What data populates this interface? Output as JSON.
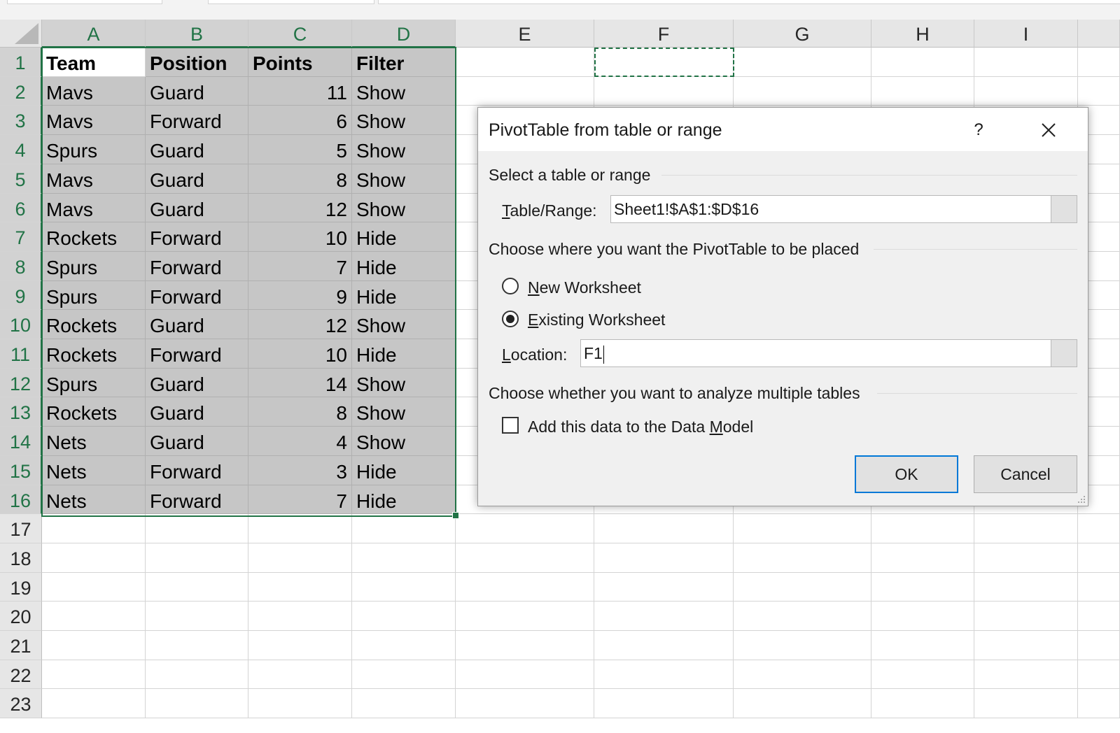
{
  "columns": [
    "A",
    "B",
    "C",
    "D",
    "E",
    "F",
    "G",
    "H",
    "I"
  ],
  "rows": [
    "1",
    "2",
    "3",
    "4",
    "5",
    "6",
    "7",
    "8",
    "9",
    "10",
    "11",
    "12",
    "13",
    "14",
    "15",
    "16",
    "17",
    "18",
    "19",
    "20",
    "21",
    "22",
    "23"
  ],
  "table": {
    "header": [
      "Team",
      "Position",
      "Points",
      "Filter"
    ],
    "rows": [
      [
        "Mavs",
        "Guard",
        "11",
        "Show"
      ],
      [
        "Mavs",
        "Forward",
        "6",
        "Show"
      ],
      [
        "Spurs",
        "Guard",
        "5",
        "Show"
      ],
      [
        "Mavs",
        "Guard",
        "8",
        "Show"
      ],
      [
        "Mavs",
        "Guard",
        "12",
        "Show"
      ],
      [
        "Rockets",
        "Forward",
        "10",
        "Hide"
      ],
      [
        "Spurs",
        "Forward",
        "7",
        "Hide"
      ],
      [
        "Spurs",
        "Forward",
        "9",
        "Hide"
      ],
      [
        "Rockets",
        "Guard",
        "12",
        "Show"
      ],
      [
        "Rockets",
        "Forward",
        "10",
        "Hide"
      ],
      [
        "Spurs",
        "Guard",
        "14",
        "Show"
      ],
      [
        "Rockets",
        "Guard",
        "8",
        "Show"
      ],
      [
        "Nets",
        "Guard",
        "4",
        "Show"
      ],
      [
        "Nets",
        "Forward",
        "3",
        "Hide"
      ],
      [
        "Nets",
        "Forward",
        "7",
        "Hide"
      ]
    ]
  },
  "dialog": {
    "title": "PivotTable from table or range",
    "help": "?",
    "section_select": "Select a table or range",
    "range_label_u": "T",
    "range_label_rest": "able/Range:",
    "range_value": "Sheet1!$A$1:$D$16",
    "section_place": "Choose where you want the PivotTable to be placed",
    "new_ws_u": "N",
    "new_ws_rest": "ew Worksheet",
    "existing_ws_u": "E",
    "existing_ws_rest": "xisting Worksheet",
    "location_label_u": "L",
    "location_label_rest": "ocation:",
    "location_value": "F1",
    "section_multi": "Choose whether you want to analyze multiple tables",
    "datamodel_pre": "Add this data to the Data ",
    "datamodel_u": "M",
    "datamodel_post": "odel",
    "ok": "OK",
    "cancel": "Cancel",
    "selected_option": "existing",
    "add_to_data_model": false
  },
  "colors": {
    "accent": "#217346",
    "selection_fill": "#c6c6c6",
    "ok_border": "#0078d7"
  }
}
